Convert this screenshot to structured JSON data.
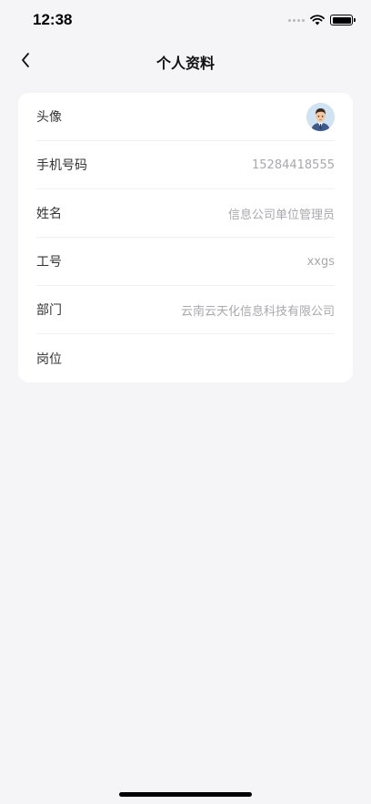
{
  "status_bar": {
    "time": "12:38",
    "icons": [
      "signal-icon",
      "wifi-icon",
      "battery-icon"
    ]
  },
  "nav": {
    "title": "个人资料",
    "back_icon": "chevron-left-icon"
  },
  "profile": {
    "rows": [
      {
        "label": "头像",
        "value": "",
        "type": "avatar"
      },
      {
        "label": "手机号码",
        "value": "15284418555"
      },
      {
        "label": "姓名",
        "value": "信息公司单位管理员"
      },
      {
        "label": "工号",
        "value": "xxgs"
      },
      {
        "label": "部门",
        "value": "云南云天化信息科技有限公司"
      },
      {
        "label": "岗位",
        "value": ""
      }
    ]
  },
  "colors": {
    "background": "#f5f5f8",
    "card": "#ffffff",
    "label": "#333333",
    "value": "#a8a8ad"
  }
}
